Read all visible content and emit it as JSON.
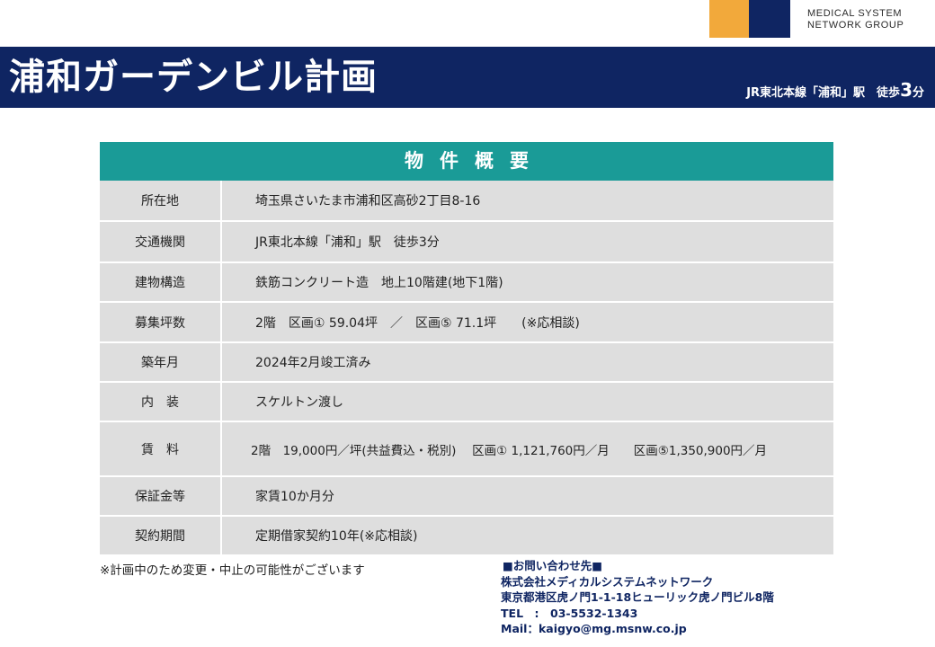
{
  "logo": {
    "colors": {
      "orange": "#f2a93b",
      "navy": "#0f2562"
    },
    "line1": "MEDICAL SYSTEM",
    "line2": "NETWORK GROUP"
  },
  "header": {
    "title": "浦和ガーデンビル計画",
    "subtitle_prefix": "JR東北本線「浦和」駅　徒歩",
    "subtitle_number": "3",
    "subtitle_unit": "分",
    "colors": {
      "bar": "#0f2562"
    }
  },
  "table": {
    "title": "物件概要",
    "colors": {
      "header": "#1a9b97",
      "row": "#dedede"
    },
    "rows": [
      {
        "label": "所在地",
        "value": "埼玉県さいたま市浦和区高砂2丁目8-16"
      },
      {
        "label": "交通機関",
        "value": "JR東北本線「浦和」駅　徒歩3分"
      },
      {
        "label": "建物構造",
        "value": "鉄筋コンクリート造　地上10階建(地下1階)"
      },
      {
        "label": "募集坪数",
        "value": "2階　区画① 59.04坪　／　区画⑤ 71.1坪　　(※応相談)"
      },
      {
        "label": "築年月",
        "value": "2024年2月竣工済み"
      },
      {
        "label": "内　装",
        "value": "スケルトン渡し"
      },
      {
        "label": "賃　料",
        "value": "2階　19,000円／坪(共益費込・税別)　 区画① 1,121,760円／月　　区画⑤1,350,900円／月"
      },
      {
        "label": "保証金等",
        "value": "家賃10か月分"
      },
      {
        "label": "契約期間",
        "value": "定期借家契約10年(※応相談)"
      }
    ]
  },
  "note": "※計画中のため変更・中止の可能性がございます",
  "contact": {
    "heading": "■お問い合わせ先■",
    "company": "株式会社メディカルシステムネットワーク",
    "address": "東京都港区虎ノ門1-1-18ヒューリック虎ノ門ビル8階",
    "tel": "TEL　:　03-5532-1343",
    "mail": "Mail：kaigyo@mg.msnw.co.jp"
  }
}
